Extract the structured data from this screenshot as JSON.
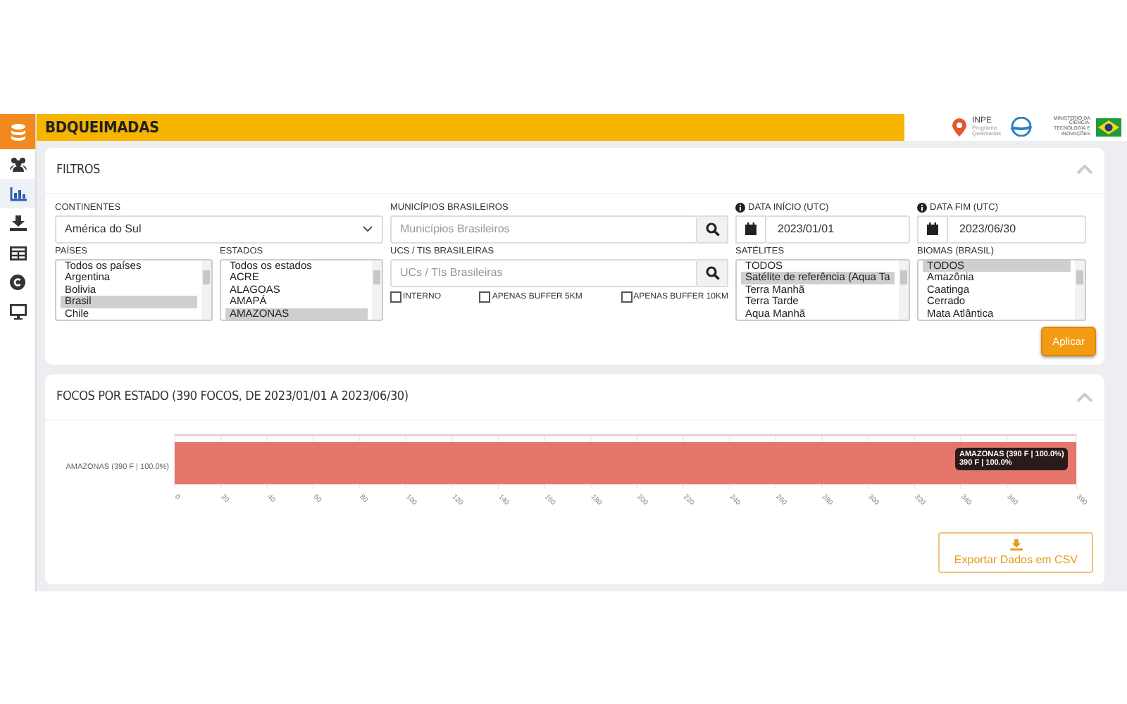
{
  "header": {
    "title": "BDQUEIMADAS",
    "logos": {
      "inpe": "INPE",
      "program": "Programa Queimadas",
      "ministry": "MINISTÉRIO DA CIÊNCIA, TECNOLOGIA E INOVAÇÕES"
    }
  },
  "sidebar": {
    "items": [
      {
        "kind": "people",
        "selected": false
      },
      {
        "kind": "chart",
        "selected": true
      },
      {
        "kind": "download",
        "selected": false
      },
      {
        "kind": "table",
        "selected": false
      },
      {
        "kind": "copyright",
        "selected": false
      },
      {
        "kind": "monitor",
        "selected": false
      }
    ]
  },
  "filters": {
    "title": "FILTROS",
    "continents": {
      "label": "CONTINENTES",
      "value": "América do Sul"
    },
    "municipios": {
      "label": "MUNICÍPIOS BRASILEIROS",
      "placeholder": "Municípios Brasileiros"
    },
    "date_start": {
      "label": "DATA INÍCIO (UTC)",
      "value": "2023/01/01"
    },
    "date_end": {
      "label": "DATA FIM (UTC)",
      "value": "2023/06/30"
    },
    "paises": {
      "label": "PAÍSES",
      "items": [
        {
          "text": "Todos os países",
          "selected": false
        },
        {
          "text": "Argentina",
          "selected": false
        },
        {
          "text": "Bolivia",
          "selected": false
        },
        {
          "text": "Brasil",
          "selected": true
        },
        {
          "text": "Chile",
          "selected": false
        }
      ]
    },
    "estados": {
      "label": "ESTADOS",
      "items": [
        {
          "text": "Todos os estados",
          "selected": false
        },
        {
          "text": "ACRE",
          "selected": false
        },
        {
          "text": "ALAGOAS",
          "selected": false
        },
        {
          "text": "AMAPÁ",
          "selected": false
        },
        {
          "text": "AMAZONAS",
          "selected": true
        }
      ]
    },
    "ucs": {
      "label": "UCS / TIS BRASILEIRAS",
      "placeholder": "UCs / TIs Brasileiras",
      "checks": [
        {
          "label": "INTERNO",
          "checked": false
        },
        {
          "label": "APENAS BUFFER 5KM",
          "checked": false
        },
        {
          "label": "APENAS BUFFER 10KM",
          "checked": false
        }
      ]
    },
    "satelites": {
      "label": "SATÉLITES",
      "items": [
        {
          "text": "TODOS",
          "selected": false
        },
        {
          "text": "Satélite de referência (Aqua Ta",
          "selected": true
        },
        {
          "text": "Terra Manhã",
          "selected": false
        },
        {
          "text": "Terra Tarde",
          "selected": false
        },
        {
          "text": "Aqua Manhã",
          "selected": false
        }
      ]
    },
    "biomas": {
      "label": "BIOMAS (BRASIL)",
      "items": [
        {
          "text": "TODOS",
          "selected": true
        },
        {
          "text": "Amazônia",
          "selected": false
        },
        {
          "text": "Caatinga",
          "selected": false
        },
        {
          "text": "Cerrado",
          "selected": false
        },
        {
          "text": "Mata Atlântica",
          "selected": false
        }
      ]
    },
    "apply_button": "Aplicar"
  },
  "chart_panel": {
    "title": "FOCOS POR ESTADO (390 FOCOS, DE 2023/01/01 A 2023/06/30)",
    "chart_data": {
      "type": "bar",
      "orientation": "horizontal",
      "grid": true,
      "categories": [
        "AMAZONAS (390 F | 100.0%)"
      ],
      "values": [
        390
      ],
      "xlim": [
        0,
        390
      ],
      "xticks": [
        0,
        20,
        40,
        60,
        80,
        100,
        120,
        140,
        160,
        180,
        200,
        220,
        240,
        260,
        280,
        300,
        320,
        340,
        360,
        390
      ]
    },
    "tooltip": {
      "title": "AMAZONAS (390 F | 100.0%)",
      "value": "390 F | 100.0%"
    },
    "export_button": "Exportar Dados em CSV"
  }
}
